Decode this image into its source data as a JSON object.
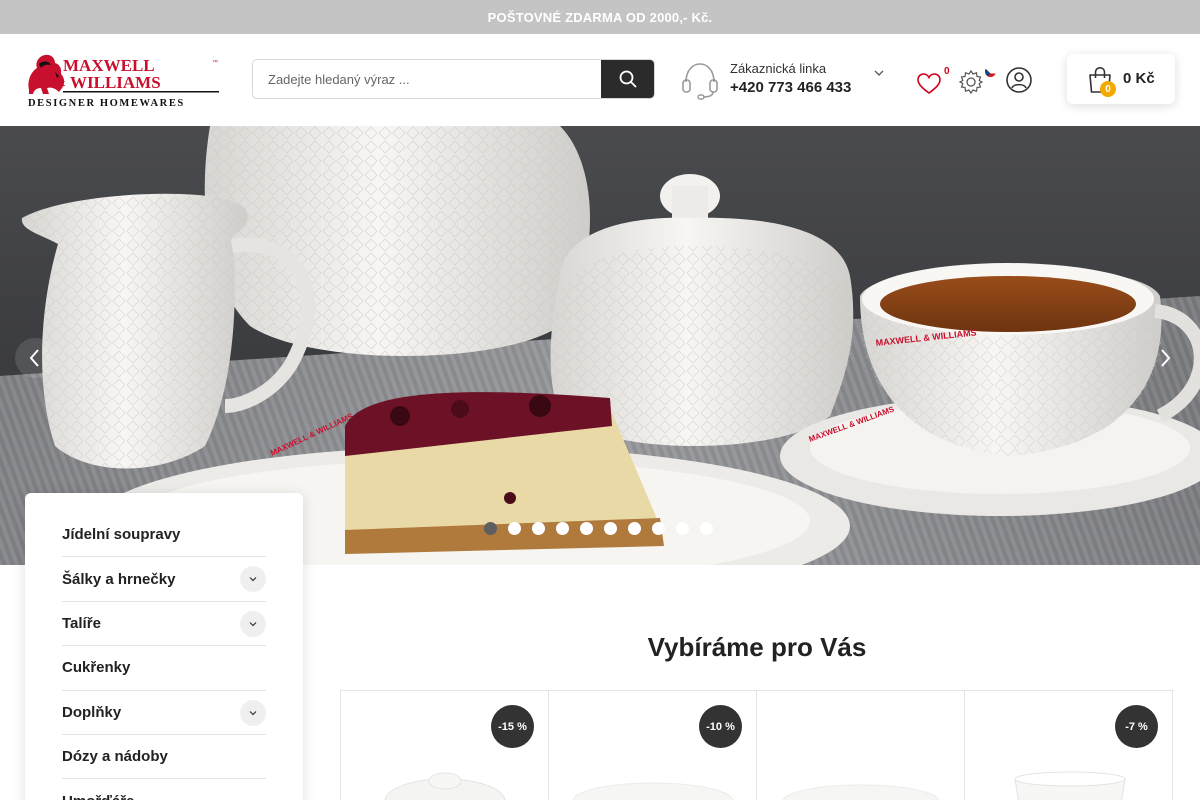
{
  "promo": {
    "text": "POŠTOVNÉ ZDARMA OD 2000,- Kč."
  },
  "logo": {
    "line1": "MAXWELL",
    "amp": "&",
    "line2": "WILLIAMS",
    "tm": "™",
    "tagline": "DESIGNER HOMEWARES",
    "brand_red": "#c8102e"
  },
  "search": {
    "placeholder": "Zadejte hledaný výraz ...",
    "value": "",
    "button_icon": "search-icon"
  },
  "hotline": {
    "label": "Zákaznická linka",
    "number": "+420 773 466 433",
    "icon": "headset-icon"
  },
  "wishlist": {
    "count": "0",
    "icon": "heart-icon"
  },
  "settings": {
    "icon": "gear-icon",
    "language": "CZ"
  },
  "account": {
    "icon": "user-icon"
  },
  "cart": {
    "count": "0",
    "total": "0 Kč",
    "icon": "shopping-bag-icon"
  },
  "slider": {
    "slides": 10,
    "active": 1,
    "prev_icon": "chevron-left-icon",
    "next_icon": "chevron-right-icon"
  },
  "categories": [
    {
      "label": "Jídelní soupravy",
      "expandable": false
    },
    {
      "label": "Šálky a hrnečky",
      "expandable": true
    },
    {
      "label": "Talíře",
      "expandable": true
    },
    {
      "label": "Cukřenky",
      "expandable": false
    },
    {
      "label": "Doplňky",
      "expandable": true
    },
    {
      "label": "Dózy a nádoby",
      "expandable": false
    },
    {
      "label": "Umořďáře",
      "expandable": false
    }
  ],
  "section": {
    "title": "Vybíráme pro Vás"
  },
  "products": [
    {
      "discount": "-15 %"
    },
    {
      "discount": "-10 %"
    },
    {
      "discount": ""
    },
    {
      "discount": "-7 %"
    }
  ],
  "colors": {
    "promo_bar": "#c4c4c4",
    "dark": "#2b2b2b",
    "accent_badge": "#f2a900",
    "wish_count": "#d0021b"
  }
}
